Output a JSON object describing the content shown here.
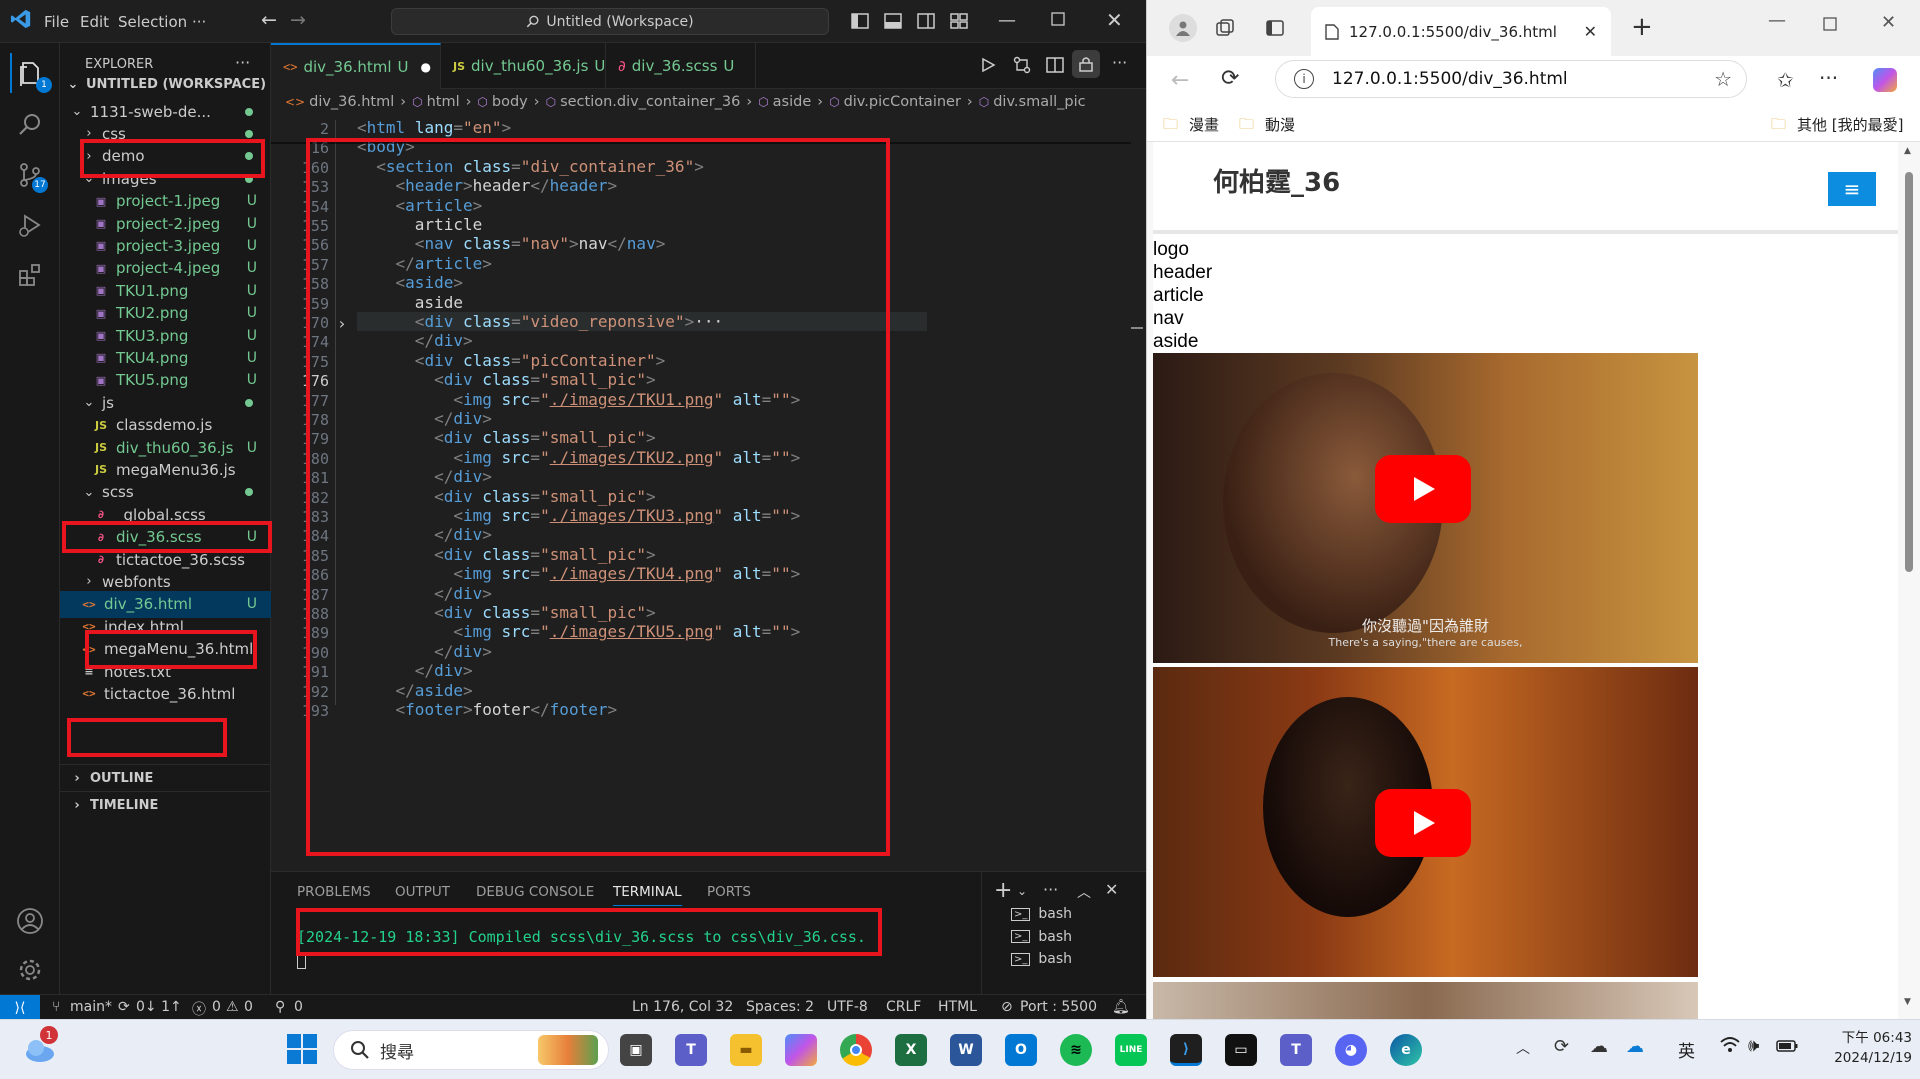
{
  "vscode": {
    "menu": [
      "File",
      "Edit",
      "Selection",
      "···"
    ],
    "command_center": "Untitled (Workspace)",
    "explorer_title": "EXPLORER",
    "workspace": "UNTITLED (WORKSPACE)",
    "tree": [
      {
        "label": "1131-sweb-de...",
        "kind": "folder-open",
        "status": "dot"
      },
      {
        "label": "css",
        "kind": "folder",
        "status": "dot"
      },
      {
        "label": "demo",
        "kind": "folder",
        "status": "dot"
      },
      {
        "label": "images",
        "kind": "folder-open",
        "status": "dot"
      },
      {
        "label": "project-1.jpeg",
        "kind": "img",
        "status": "U"
      },
      {
        "label": "project-2.jpeg",
        "kind": "img",
        "status": "U"
      },
      {
        "label": "project-3.jpeg",
        "kind": "img",
        "status": "U"
      },
      {
        "label": "project-4.jpeg",
        "kind": "img",
        "status": "U"
      },
      {
        "label": "TKU1.png",
        "kind": "img",
        "status": "U"
      },
      {
        "label": "TKU2.png",
        "kind": "img",
        "status": "U"
      },
      {
        "label": "TKU3.png",
        "kind": "img",
        "status": "U"
      },
      {
        "label": "TKU4.png",
        "kind": "img",
        "status": "U"
      },
      {
        "label": "TKU5.png",
        "kind": "img",
        "status": "U"
      },
      {
        "label": "js",
        "kind": "folder-open",
        "status": "dot"
      },
      {
        "label": "classdemo.js",
        "kind": "js",
        "status": ""
      },
      {
        "label": "div_thu60_36.js",
        "kind": "js",
        "status": "U"
      },
      {
        "label": "megaMenu36.js",
        "kind": "js",
        "status": ""
      },
      {
        "label": "scss",
        "kind": "folder-open",
        "status": "dot"
      },
      {
        "label": "_global.scss",
        "kind": "scss",
        "status": ""
      },
      {
        "label": "div_36.scss",
        "kind": "scss",
        "status": "U"
      },
      {
        "label": "tictactoe_36.scss",
        "kind": "scss",
        "status": ""
      },
      {
        "label": "webfonts",
        "kind": "folder",
        "status": ""
      },
      {
        "label": "div_36.html",
        "kind": "html",
        "status": "U"
      },
      {
        "label": "index.html",
        "kind": "html",
        "status": ""
      },
      {
        "label": "megaMenu_36.html",
        "kind": "html",
        "status": ""
      },
      {
        "label": "notes.txt",
        "kind": "txt",
        "status": ""
      },
      {
        "label": "tictactoe_36.html",
        "kind": "html",
        "status": ""
      }
    ],
    "outline": "OUTLINE",
    "timeline": "TIMELINE",
    "badges": {
      "scm": "17",
      "explorer": "1"
    },
    "tabs": [
      {
        "name": "div_36.html",
        "status": "U",
        "kind": "html"
      },
      {
        "name": "div_thu60_36.js",
        "status": "U",
        "kind": "js"
      },
      {
        "name": "div_36.scss",
        "status": "U",
        "kind": "scss"
      }
    ],
    "breadcrumb": [
      "div_36.html",
      "html",
      "body",
      "section.div_container_36",
      "aside",
      "div.picContainer",
      "div.small_pic"
    ],
    "lines": [
      {
        "n": "2",
        "t": "<html lang=\"en\">"
      },
      {
        "n": "16",
        "t": "<body>"
      },
      {
        "n": "160",
        "t": "  <section class=\"div_container_36\">"
      },
      {
        "n": "153",
        "t": "    <header>header</header>"
      },
      {
        "n": "154",
        "t": "    <article>"
      },
      {
        "n": "155",
        "t": "      article"
      },
      {
        "n": "156",
        "t": "      <nav class=\"nav\">nav</nav>"
      },
      {
        "n": "157",
        "t": "    </article>"
      },
      {
        "n": "158",
        "t": "    <aside>"
      },
      {
        "n": "159",
        "t": "      aside"
      },
      {
        "n": "170",
        "t": "      <div class=\"video_reponsive\">···"
      },
      {
        "n": "174",
        "t": "      </div>"
      },
      {
        "n": "175",
        "t": "      <div class=\"picContainer\">"
      },
      {
        "n": "176",
        "t": "        <div class=\"small_pic\">"
      },
      {
        "n": "177",
        "t": "          <img src=\"./images/TKU1.png\" alt=\"\">"
      },
      {
        "n": "178",
        "t": "        </div>"
      },
      {
        "n": "179",
        "t": "        <div class=\"small_pic\">"
      },
      {
        "n": "180",
        "t": "          <img src=\"./images/TKU2.png\" alt=\"\">"
      },
      {
        "n": "181",
        "t": "        </div>"
      },
      {
        "n": "182",
        "t": "        <div class=\"small_pic\">"
      },
      {
        "n": "183",
        "t": "          <img src=\"./images/TKU3.png\" alt=\"\">"
      },
      {
        "n": "184",
        "t": "        </div>"
      },
      {
        "n": "185",
        "t": "        <div class=\"small_pic\">"
      },
      {
        "n": "186",
        "t": "          <img src=\"./images/TKU4.png\" alt=\"\">"
      },
      {
        "n": "187",
        "t": "        </div>"
      },
      {
        "n": "188",
        "t": "        <div class=\"small_pic\">"
      },
      {
        "n": "189",
        "t": "          <img src=\"./images/TKU5.png\" alt=\"\">"
      },
      {
        "n": "190",
        "t": "        </div>"
      },
      {
        "n": "191",
        "t": "      </div>"
      },
      {
        "n": "192",
        "t": "    </aside>"
      },
      {
        "n": "193",
        "t": "    <footer>footer</footer>"
      }
    ],
    "panel_tabs": [
      "PROBLEMS",
      "OUTPUT",
      "DEBUG CONSOLE",
      "TERMINAL",
      "PORTS"
    ],
    "terminal_line": "[2024-12-19 18:33] Compiled scss\\div_36.scss to css\\div_36.css.",
    "terminals": [
      "bash",
      "bash",
      "bash"
    ],
    "status": {
      "branch": "main*",
      "sync": "0↓ 1↑",
      "problems": "0",
      "warnings": "0",
      "ports": "0",
      "position": "Ln 176, Col 32",
      "spaces": "Spaces: 2",
      "encoding": "UTF-8",
      "eol": "CRLF",
      "language": "HTML",
      "port": "Port : 5500"
    }
  },
  "browser": {
    "tab_title": "127.0.0.1:5500/div_36.html",
    "url": "127.0.0.1:5500/div_36.html",
    "bookmarks": [
      "漫畫",
      "動漫"
    ],
    "bookmarks_right": "其他 [我的最愛]",
    "page": {
      "title": "何柏霆_36",
      "items": [
        "logo",
        "header",
        "article",
        "nav",
        "aside"
      ],
      "subtitle_cn": "你沒聽過\"因為誰財",
      "subtitle_en": "There's a saying,\"there are causes,"
    }
  },
  "taskbar": {
    "search": "搜尋",
    "notifications": "1",
    "ime": "英",
    "time": "下午 06:43",
    "date": "2024/12/19"
  },
  "colors": {
    "accent": "#0078d4",
    "highlight": "#e8141e",
    "browser_menu": "#0d8de0"
  }
}
